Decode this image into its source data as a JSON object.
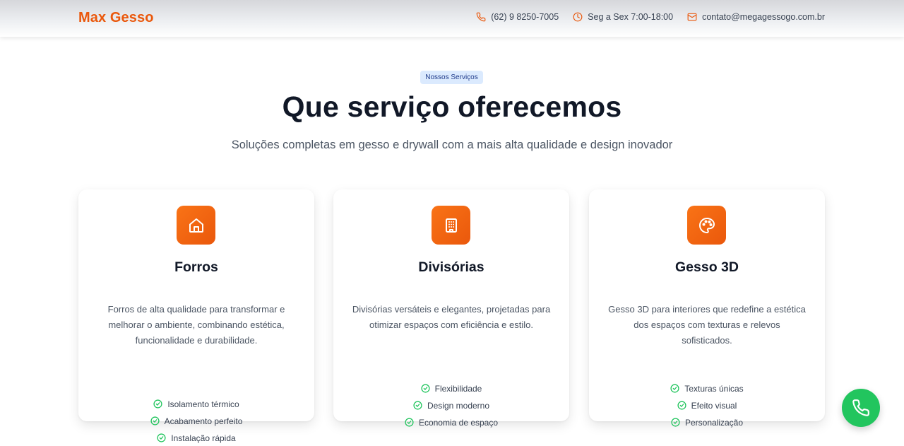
{
  "header": {
    "brand": "Max Gesso",
    "phone": "(62) 9 8250-7005",
    "hours": "Seg a Sex 7:00-18:00",
    "email": "contato@megagessogo.com.br",
    "icons": [
      "phone-icon",
      "clock-icon",
      "mail-icon"
    ]
  },
  "section": {
    "badge": "Nossos Serviços",
    "title": "Que serviço oferecemos",
    "subtitle": "Soluções completas em gesso e drywall com a mais alta qualidade e design inovador"
  },
  "cards": [
    {
      "icon": "home-icon",
      "title": "Forros",
      "description": "Forros de alta qualidade para transformar e melhorar o ambiente, combinando estética, funcionalidade e durabilidade.",
      "features": [
        "Isolamento térmico",
        "Acabamento perfeito",
        "Instalação rápida"
      ]
    },
    {
      "icon": "building-icon",
      "title": "Divisórias",
      "description": "Divisórias versáteis e elegantes, projetadas para otimizar espaços com eficiência e estilo.",
      "features": [
        "Flexibilidade",
        "Design moderno",
        "Economia de espaço"
      ]
    },
    {
      "icon": "palette-icon",
      "title": "Gesso 3D",
      "description": "Gesso 3D para interiores que redefine a estética dos espaços com texturas e relevos sofisticados.",
      "features": [
        "Texturas únicas",
        "Efeito visual",
        "Personalização"
      ]
    }
  ],
  "fab": {
    "icon": "phone-icon"
  },
  "colors": {
    "accent": "#ea580c",
    "badge_bg": "#dbeafe",
    "badge_text": "#1e3a8a",
    "check": "#22c55e",
    "fab": "#22c55e"
  }
}
